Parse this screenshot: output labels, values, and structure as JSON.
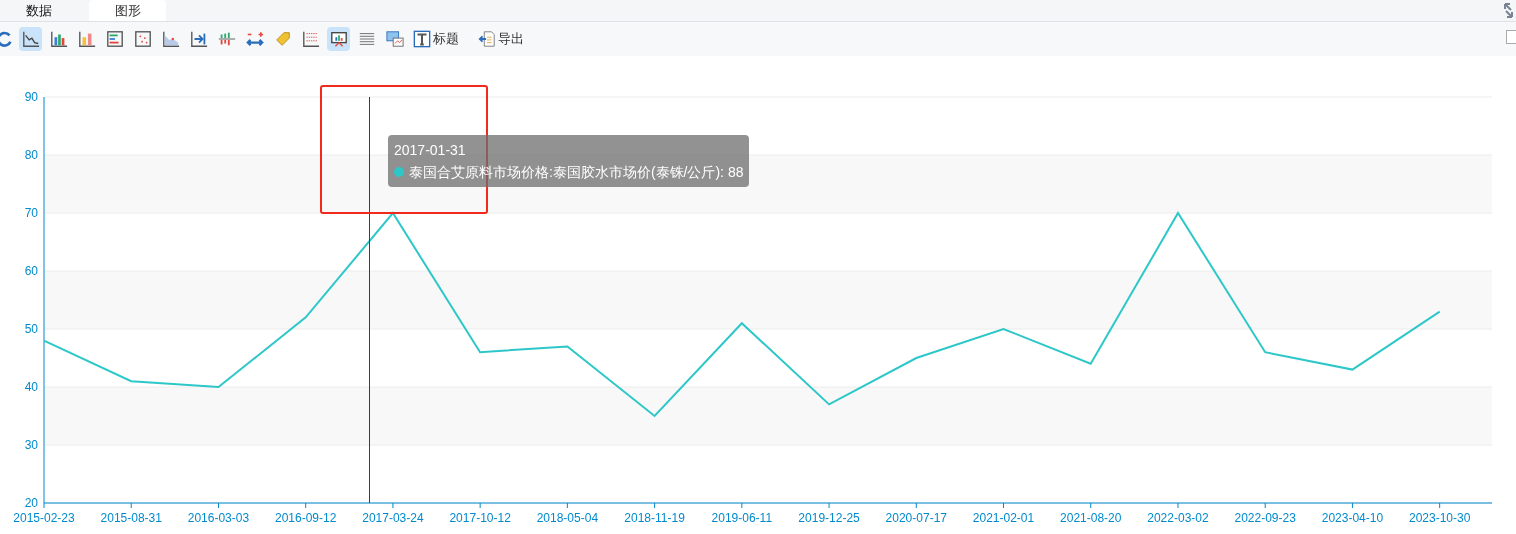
{
  "tabs": [
    {
      "label": "数据",
      "selected": false
    },
    {
      "label": "图形",
      "selected": true
    }
  ],
  "toolbar": [
    {
      "kind": "icon",
      "selected": false
    },
    {
      "kind": "icon",
      "selected": true
    },
    {
      "kind": "icon",
      "selected": false
    },
    {
      "kind": "icon",
      "selected": false
    },
    {
      "kind": "icon",
      "selected": false
    },
    {
      "kind": "icon",
      "selected": false
    },
    {
      "kind": "icon",
      "selected": false
    },
    {
      "kind": "icon",
      "selected": false
    },
    {
      "kind": "icon",
      "selected": false
    },
    {
      "kind": "icon",
      "selected": false
    },
    {
      "kind": "icon",
      "selected": false
    },
    {
      "kind": "icon",
      "selected": false
    },
    {
      "kind": "icon",
      "selected": true
    },
    {
      "kind": "icon",
      "selected": false
    },
    {
      "kind": "icon",
      "selected": false
    },
    {
      "kind": "labeled",
      "label": "标题",
      "selected": false
    },
    {
      "kind": "labeled",
      "label": "导出",
      "selected": false
    }
  ],
  "checkbox": {
    "checked": false
  },
  "chart": {
    "chart_data": {
      "type": "line",
      "grid": true,
      "ylim": [
        20,
        90
      ],
      "yticks": [
        20,
        30,
        40,
        50,
        60,
        70,
        80,
        90
      ],
      "categories": [
        "2015-02-23",
        "2015-08-31",
        "2016-03-03",
        "2016-09-12",
        "2017-03-24",
        "2017-10-12",
        "2018-05-04",
        "2018-11-19",
        "2019-06-11",
        "2019-12-25",
        "2020-07-17",
        "2021-02-01",
        "2021-08-20",
        "2022-03-02",
        "2022-09-23",
        "2023-04-10",
        "2023-10-30"
      ],
      "series": [
        {
          "name": "泰国合艾原料市场价格:泰国胶水市场价(泰铢/公斤)",
          "color": "#2ec7c9",
          "values": [
            48,
            41,
            40,
            52,
            70,
            46,
            47,
            35,
            51,
            37,
            45,
            50,
            44,
            70,
            46,
            43,
            53
          ]
        }
      ]
    },
    "tooltip": {
      "title": "2017-01-31",
      "value": ": 88"
    }
  }
}
